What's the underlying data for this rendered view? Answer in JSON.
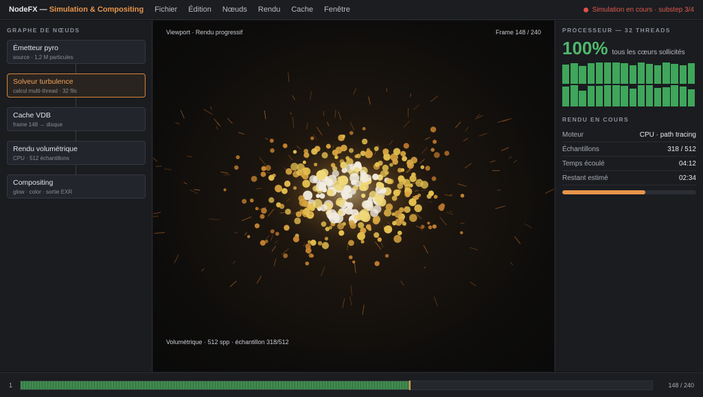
{
  "app": {
    "name": "NodeFX —",
    "title": "Simulation & Compositing"
  },
  "menu": [
    "Fichier",
    "Édition",
    "Nœuds",
    "Rendu",
    "Cache",
    "Fenêtre"
  ],
  "sim_status": "Simulation en cours · substep 3/4",
  "node_graph": {
    "title": "GRAPHE DE NŒUDS",
    "nodes": [
      {
        "title": "Émetteur pyro",
        "sub": "source · 1,2 M particules"
      },
      {
        "title": "Solveur turbulence",
        "sub": "calcul multi-thread · 32 fils"
      },
      {
        "title": "Cache VDB",
        "sub": "frame 148 → disque"
      },
      {
        "title": "Rendu volumétrique",
        "sub": "CPU · 512 échantillons"
      },
      {
        "title": "Compositing",
        "sub": "glow · color · sortie EXR"
      }
    ],
    "active_index": 1
  },
  "viewport": {
    "label_tl": "Viewport · Rendu progressif",
    "label_tr": "Frame 148 / 240",
    "label_bl": "Volumétrique · 512 spp · échantillon 318/512"
  },
  "cpu": {
    "title": "PROCESSEUR — 32 THREADS",
    "percent": "100%",
    "note": "tous les cœurs sollicités",
    "core_levels": [
      0.88,
      0.95,
      0.82,
      0.93,
      0.96,
      0.98,
      0.97,
      0.95,
      0.86,
      0.96,
      0.91,
      0.83,
      0.98,
      0.92,
      0.84,
      0.95,
      0.92,
      0.96,
      0.72,
      0.93,
      0.94,
      0.97,
      0.98,
      0.93,
      0.81,
      0.98,
      0.97,
      0.86,
      0.88,
      0.96,
      0.91,
      0.79
    ]
  },
  "render": {
    "title": "RENDU EN COURS",
    "stats": [
      {
        "label": "Moteur",
        "value": "CPU · path tracing"
      },
      {
        "label": "Échantillons",
        "value": "318 / 512"
      },
      {
        "label": "Temps écoulé",
        "value": "04:12"
      },
      {
        "label": "Restant estimé",
        "value": "02:34"
      }
    ],
    "progress": 0.621
  },
  "timeline": {
    "start": "1",
    "end": "148 / 240",
    "current": 148,
    "total": 240
  },
  "colors": {
    "accent": "#e8954a",
    "cpu_green": "#4fb86b",
    "alert": "#e05a4e"
  }
}
